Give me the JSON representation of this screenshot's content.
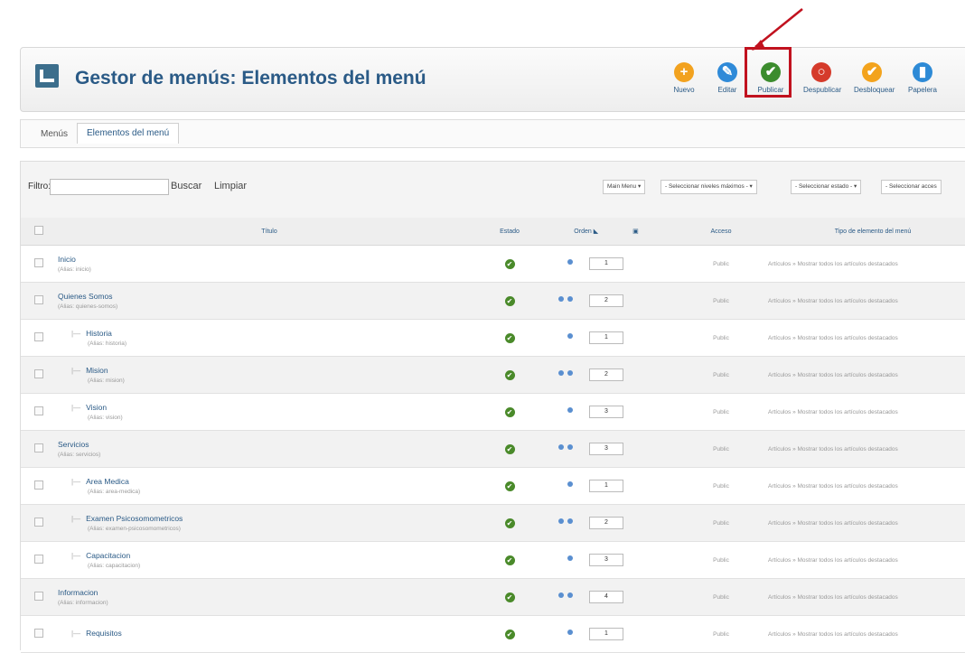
{
  "header": {
    "title": "Gestor de menús: Elementos del menú"
  },
  "toolbar": [
    {
      "label": "Nuevo",
      "color": "#f2a21f",
      "glyph": "+"
    },
    {
      "label": "Editar",
      "color": "#2f8ad8",
      "glyph": "✎"
    },
    {
      "label": "Publicar",
      "color": "#3c8c2e",
      "glyph": "✔"
    },
    {
      "label": "Despublicar",
      "color": "#d53b2b",
      "glyph": "○"
    },
    {
      "label": "Desbloquear",
      "color": "#f3a31d",
      "glyph": "✔"
    },
    {
      "label": "Papelera",
      "color": "#2d8ad6",
      "glyph": "▮"
    }
  ],
  "subtabs": {
    "menus": "Menús",
    "items": "Elementos del menú"
  },
  "filters": {
    "label": "Filtro:",
    "search_value": "",
    "search_btn": "Buscar",
    "clear_btn": "Limpiar",
    "selects": [
      "Main Menu ▾",
      "- Seleccionar niveles máximos - ▾",
      "- Seleccionar estado - ▾",
      "- Seleccionar acces"
    ]
  },
  "columns": {
    "titulo": "Título",
    "estado": "Estado",
    "orden": "Orden",
    "acceso": "Acceso",
    "tipo": "Tipo de elemento del menú"
  },
  "rows": [
    {
      "title": "Inicio",
      "alias": "(Alias: inicio)",
      "indent": 0,
      "order": "1",
      "arrows": 1,
      "access": "Public",
      "type": "Artículos » Mostrar todos los artículos destacados"
    },
    {
      "title": "Quienes Somos",
      "alias": "(Alias: quienes-somos)",
      "indent": 0,
      "order": "2",
      "arrows": 2,
      "access": "Public",
      "type": "Artículos » Mostrar todos los artículos destacados"
    },
    {
      "title": "Historia",
      "alias": "(Alias: historia)",
      "indent": 1,
      "order": "1",
      "arrows": 1,
      "access": "Public",
      "type": "Artículos » Mostrar todos los artículos destacados"
    },
    {
      "title": "Mision",
      "alias": "(Alias: mision)",
      "indent": 1,
      "order": "2",
      "arrows": 2,
      "access": "Public",
      "type": "Artículos » Mostrar todos los artículos destacados"
    },
    {
      "title": "Vision",
      "alias": "(Alias: vision)",
      "indent": 1,
      "order": "3",
      "arrows": 1,
      "access": "Public",
      "type": "Artículos » Mostrar todos los artículos destacados"
    },
    {
      "title": "Servicios",
      "alias": "(Alias: servicios)",
      "indent": 0,
      "order": "3",
      "arrows": 2,
      "access": "Public",
      "type": "Artículos » Mostrar todos los artículos destacados"
    },
    {
      "title": "Area Medica",
      "alias": "(Alias: area-medica)",
      "indent": 1,
      "order": "1",
      "arrows": 1,
      "access": "Public",
      "type": "Artículos » Mostrar todos los artículos destacados"
    },
    {
      "title": "Examen Psicosomometricos",
      "alias": "(Alias: examen-psicosomometricos)",
      "indent": 1,
      "order": "2",
      "arrows": 2,
      "access": "Public",
      "type": "Artículos » Mostrar todos los artículos destacados"
    },
    {
      "title": "Capacitacion",
      "alias": "(Alias: capacitacion)",
      "indent": 1,
      "order": "3",
      "arrows": 1,
      "access": "Public",
      "type": "Artículos » Mostrar todos los artículos destacados"
    },
    {
      "title": "Informacion",
      "alias": "(Alias: informacion)",
      "indent": 0,
      "order": "4",
      "arrows": 2,
      "access": "Public",
      "type": "Artículos » Mostrar todos los artículos destacados"
    },
    {
      "title": "Requisitos",
      "alias": "",
      "indent": 1,
      "order": "1",
      "arrows": 1,
      "access": "Public",
      "type": "Artículos » Mostrar todos los artículos destacados"
    }
  ]
}
